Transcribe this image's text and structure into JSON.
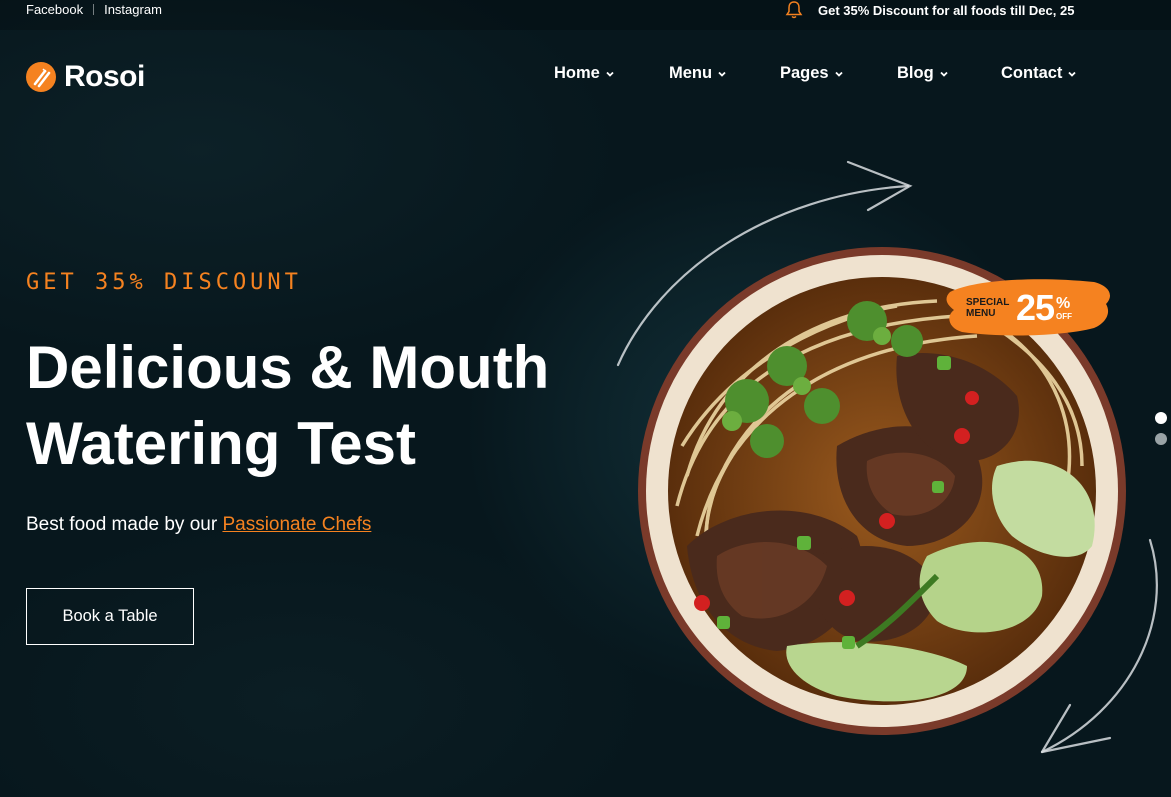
{
  "topbar": {
    "social": [
      "Facebook",
      "Instagram"
    ],
    "promo_text": "Get 35% Discount for all foods till Dec, 25",
    "promo_icon": "bell-icon"
  },
  "brand": {
    "name": "Rosoi",
    "logo_icon": "fork-knife-icon",
    "accent": "#f58220"
  },
  "nav": {
    "items": [
      {
        "label": "Home"
      },
      {
        "label": "Menu"
      },
      {
        "label": "Pages"
      },
      {
        "label": "Blog"
      },
      {
        "label": "Contact"
      }
    ]
  },
  "hero": {
    "eyebrow": "GET 35% DISCOUNT",
    "headline_line1": "Delicious & Mouth",
    "headline_line2": "Watering Test",
    "subtext": "Best food made by our ",
    "subtext_link": "Passionate Chefs",
    "cta_label": "Book a Table"
  },
  "badge": {
    "small_line1": "SPECIAL",
    "small_line2": "MENU",
    "value": "25",
    "percent": "%",
    "off": "OFF"
  },
  "slider": {
    "active_index": 0,
    "count": 2
  }
}
